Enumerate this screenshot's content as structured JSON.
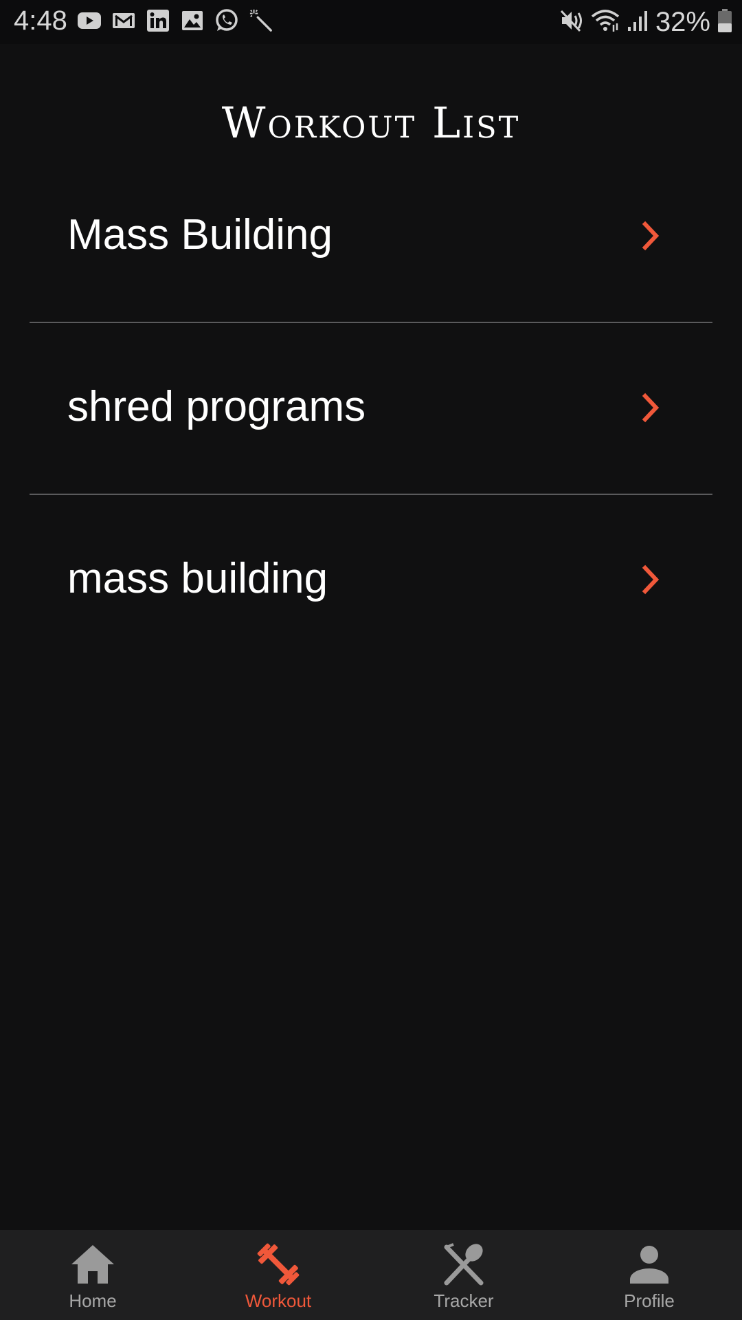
{
  "status_bar": {
    "time": "4:48",
    "battery_percent": "32%",
    "left_icons": [
      "youtube-icon",
      "gmail-icon",
      "linkedin-icon",
      "gallery-icon",
      "whatsapp-icon",
      "magic-wand-icon"
    ],
    "right_icons": [
      "mute-icon",
      "wifi-icon",
      "signal-icon",
      "battery-icon"
    ]
  },
  "header": {
    "title": "Workout List"
  },
  "workouts": [
    {
      "label": "Mass Building"
    },
    {
      "label": "shred programs"
    },
    {
      "label": "mass building"
    }
  ],
  "bottom_nav": {
    "items": [
      {
        "label": "Home",
        "icon": "home-icon",
        "active": false
      },
      {
        "label": "Workout",
        "icon": "dumbbell-icon",
        "active": true
      },
      {
        "label": "Tracker",
        "icon": "fork-spoon-icon",
        "active": false
      },
      {
        "label": "Profile",
        "icon": "person-icon",
        "active": false
      }
    ]
  },
  "colors": {
    "background": "#101011",
    "accent": "#f0583a",
    "nav_background": "#1f1f20",
    "inactive": "#a8a8a8",
    "divider": "#5a5a5c"
  }
}
